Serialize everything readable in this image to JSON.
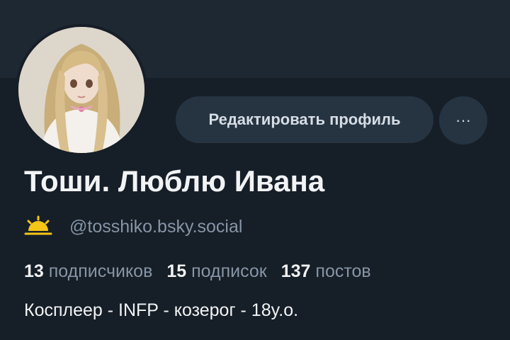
{
  "profile": {
    "edit_button_label": "Редактировать профиль",
    "more_button_label": "···",
    "display_name": "Тоши. Люблю Ивана",
    "handle": "@tosshiko.bsky.social",
    "handle_icon": "sun-weather-icon",
    "stats": {
      "followers_count": "13",
      "followers_label": "подписчиков",
      "following_count": "15",
      "following_label": "подписок",
      "posts_count": "137",
      "posts_label": "постов"
    },
    "bio": "Косплеер - INFP - козерог - 18y.o."
  },
  "colors": {
    "background": "#161e27",
    "banner": "#1e2833",
    "button_bg": "#263442",
    "muted_text": "#8795a6",
    "primary_text": "#f1f3f5",
    "sun_icon": "#f5c518"
  }
}
